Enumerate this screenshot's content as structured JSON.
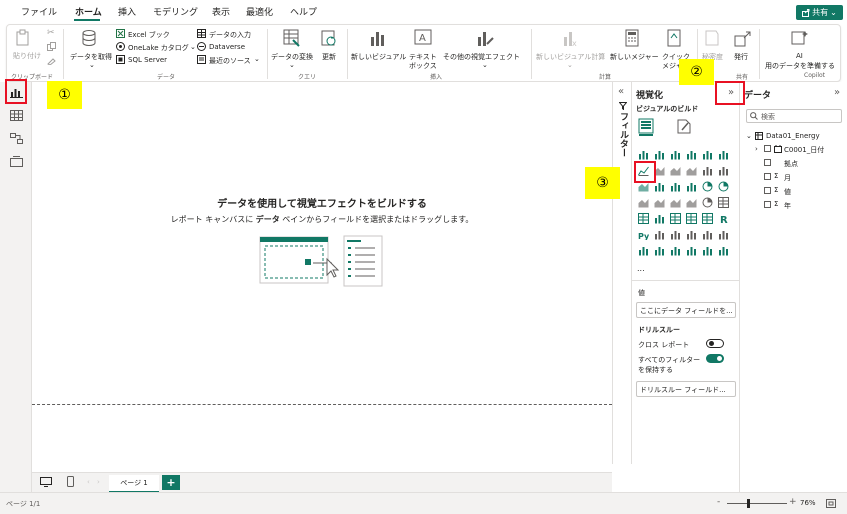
{
  "menu": {
    "tabs": [
      "ファイル",
      "ホーム",
      "挿入",
      "モデリング",
      "表示",
      "最適化",
      "ヘルプ"
    ],
    "share_label": "共有"
  },
  "ribbon": {
    "paste": "貼り付け",
    "clipboard": "クリップボード",
    "get_data": "データを取得",
    "excel": "Excel ブック",
    "onelake": "OneLake カタログ",
    "sql": "SQL Server",
    "enter_data": "データの入力",
    "dataverse": "Dataverse",
    "recent": "最近のソース",
    "data_group": "データ",
    "transform": "データの変換",
    "refresh": "更新",
    "query_group": "クエリ",
    "new_visual": "新しいビジュアル",
    "textbox_1": "テキスト",
    "textbox_2": "ボックス",
    "more_visuals": "その他の視覚エフェクト",
    "insert_group": "挿入",
    "new_visual_calc": "新しいビジュアル計算",
    "new_measure": "新しいメジャー",
    "quick_measure_1": "クイック",
    "quick_measure_2": "メジャー",
    "calc_group": "計算",
    "sensitivity": "秘密度",
    "publish": "発行",
    "share_group": "共有",
    "ai": "AI",
    "copilot_prepare": "用のデータを準備する",
    "copilot_group": "Copilot"
  },
  "canvas": {
    "title": "データを使用して視覚エフェクトをビルドする",
    "subtitle_pre": "レポート キャンバスに ",
    "subtitle_bold": "データ",
    "subtitle_post": " ペインからフィールドを選択またはドラッグします。"
  },
  "filters": {
    "label": "フィルター"
  },
  "viz": {
    "title": "視覚化",
    "build_label": "ビジュアルのビルド",
    "more": "...",
    "values_label": "値",
    "values_placeholder": "ここにデータ フィールドを...",
    "drill_label": "ドリルスルー",
    "cross_report": "クロス レポート",
    "cross_report_state": "オフ",
    "keep_filters_1": "すべてのフィルター",
    "keep_filters_2": "を保持する",
    "keep_filters_state": "オン",
    "drill_placeholder": "ドリルスルー フィールド..."
  },
  "data": {
    "title": "データ",
    "search_placeholder": "検索",
    "table": "Data01_Energy",
    "fields": [
      "C0001_日付",
      "拠点",
      "月",
      "値",
      "年"
    ]
  },
  "pages": {
    "tab": "ページ 1",
    "add": "+"
  },
  "status": {
    "page": "ページ 1/1",
    "zoom": "76%"
  },
  "annotations": {
    "one": "①",
    "two": "②",
    "three": "③"
  },
  "colors": {
    "accent": "#117865",
    "highlight": "#ffff00",
    "callout_border": "#e81123"
  }
}
